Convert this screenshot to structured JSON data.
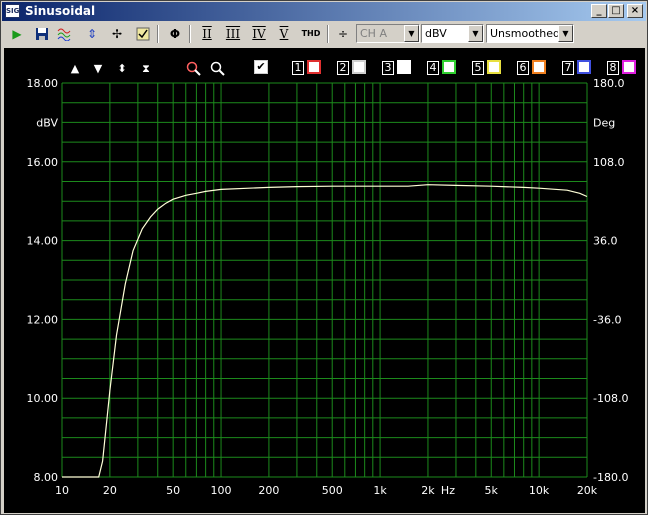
{
  "window": {
    "title": "Sinusoidal",
    "icon_text": "SIG"
  },
  "toolbar": {
    "mode1": "I",
    "mode2": "II",
    "mode3": "III",
    "mode4": "IV",
    "mode5": "V",
    "thd": "THD",
    "channel": "CH A",
    "unit": "dBV",
    "smoothing": "Unsmoothed"
  },
  "channels": [
    {
      "num": "1",
      "color": "#e03030"
    },
    {
      "num": "2",
      "color": "#d0d0d0"
    },
    {
      "num": "3",
      "color": "#ffffff"
    },
    {
      "num": "4",
      "color": "#30d030"
    },
    {
      "num": "5",
      "color": "#e8e040"
    },
    {
      "num": "6",
      "color": "#f08020"
    },
    {
      "num": "7",
      "color": "#4050e0"
    },
    {
      "num": "8",
      "color": "#e020e0"
    }
  ],
  "colors": {
    "grid": "#1c8a1c",
    "trace": "#ffffd8",
    "background": "#000000"
  },
  "chart_data": {
    "type": "line",
    "y_label": "dBV",
    "y2_label": "Deg",
    "x_unit": "Hz",
    "x_scale": "log",
    "xlim": [
      10,
      20000
    ],
    "ylim": [
      8.0,
      18.0
    ],
    "y2lim": [
      -180.0,
      180.0
    ],
    "y_ticks": [
      "8.00",
      "10.00",
      "12.00",
      "14.00",
      "16.00",
      "18.00"
    ],
    "y2_ticks": [
      "-180.0",
      "-108.0",
      "-36.0",
      "36.0",
      "108.0",
      "180.0"
    ],
    "x_tick_labels": [
      {
        "v": 10,
        "t": "10"
      },
      {
        "v": 20,
        "t": "20"
      },
      {
        "v": 50,
        "t": "50"
      },
      {
        "v": 100,
        "t": "100"
      },
      {
        "v": 200,
        "t": "200"
      },
      {
        "v": 500,
        "t": "500"
      },
      {
        "v": 1000,
        "t": "1k"
      },
      {
        "v": 2000,
        "t": "2k"
      },
      {
        "v": 5000,
        "t": "5k"
      },
      {
        "v": 10000,
        "t": "10k"
      },
      {
        "v": 20000,
        "t": "20k"
      }
    ],
    "series": [
      {
        "x": [
          10,
          17,
          18,
          20,
          22,
          25,
          28,
          32,
          36,
          40,
          45,
          50,
          60,
          70,
          80,
          100,
          150,
          200,
          300,
          500,
          800,
          1000,
          1500,
          2000,
          3000,
          5000,
          8000,
          10000,
          15000,
          18000,
          20000
        ],
        "y": [
          8.0,
          8.0,
          8.4,
          10.2,
          11.6,
          12.9,
          13.75,
          14.3,
          14.6,
          14.8,
          14.95,
          15.05,
          15.15,
          15.2,
          15.25,
          15.3,
          15.33,
          15.35,
          15.37,
          15.38,
          15.38,
          15.38,
          15.38,
          15.42,
          15.4,
          15.38,
          15.35,
          15.33,
          15.28,
          15.2,
          15.12
        ]
      }
    ]
  }
}
